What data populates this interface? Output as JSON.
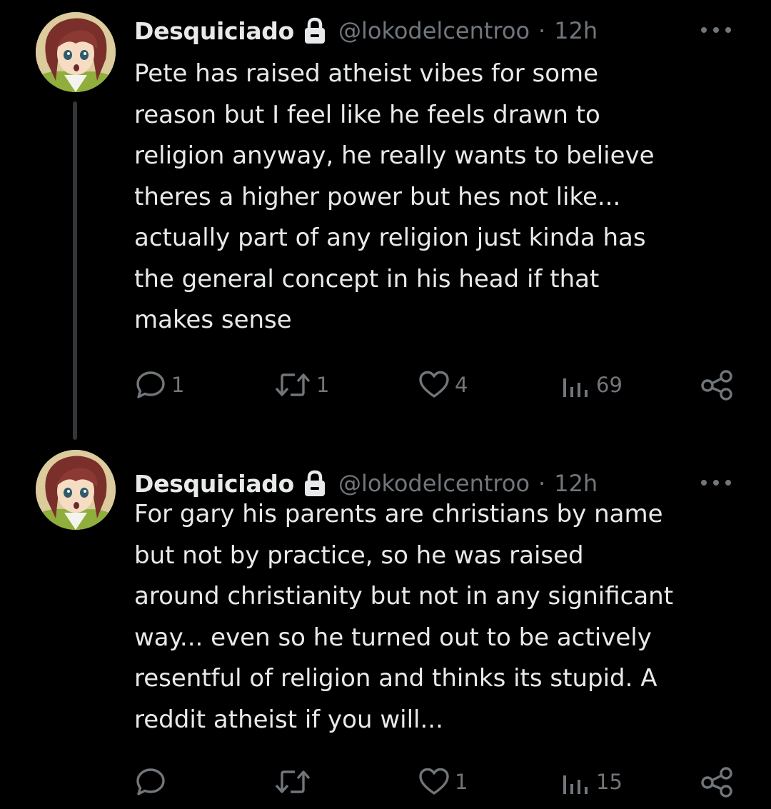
{
  "tweets": [
    {
      "author": {
        "name": "Desquiciado",
        "handle": "@lokodelcentroo",
        "protected_icon": "lock-icon",
        "avatar": "anime-character-avatar"
      },
      "separator": "·",
      "time": "12h",
      "text": "Pete has raised atheist vibes for some\nreason but I feel like he feels drawn to\nreligion anyway, he really wants to believe\ntheres a higher power but hes not like...\nactually part of any religion just kinda has\nthe general concept in his head if that\nmakes sense",
      "stats": {
        "replies": "1",
        "retweets": "1",
        "likes": "4",
        "views": "69"
      }
    },
    {
      "author": {
        "name": "Desquiciado",
        "handle": "@lokodelcentroo",
        "protected_icon": "lock-icon",
        "avatar": "anime-character-avatar"
      },
      "separator": "·",
      "time": "12h",
      "text": "For gary his parents are christians by name\nbut not by practice, so he was raised\naround christianity but not in any significant\nway... even so he turned out to be actively\nresentful of religion and thinks its stupid. A\nreddit atheist if you will...",
      "stats": {
        "replies": "",
        "retweets": "",
        "likes": "1",
        "views": "15"
      }
    }
  ],
  "icons": {
    "reply": "reply-icon",
    "retweet": "retweet-icon",
    "like": "heart-icon",
    "views": "views-icon",
    "share": "share-icon",
    "more": "more-icon"
  },
  "colors": {
    "background": "#000000",
    "text_primary": "#e7e9ea",
    "text_secondary": "#71767b",
    "thread_line": "#333639"
  }
}
